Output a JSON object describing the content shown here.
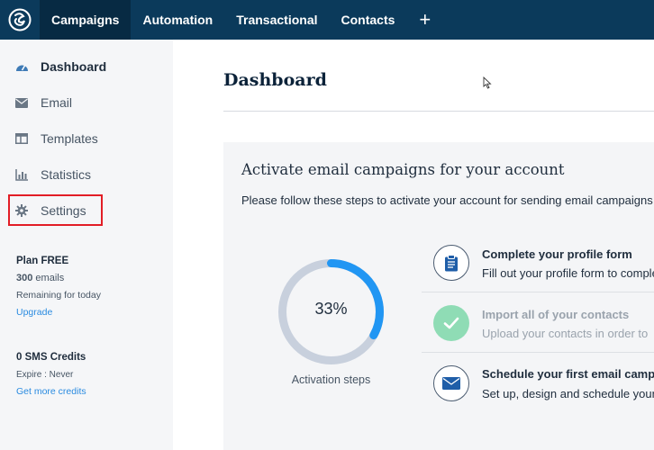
{
  "topnav": {
    "items": [
      {
        "label": "Campaigns",
        "active": true
      },
      {
        "label": "Automation",
        "active": false
      },
      {
        "label": "Transactional",
        "active": false
      },
      {
        "label": "Contacts",
        "active": false
      }
    ],
    "plus": "+",
    "bg_color": "#0b3a5b"
  },
  "sidebar": {
    "items": [
      {
        "label": "Dashboard",
        "icon": "speedometer-icon",
        "active": true
      },
      {
        "label": "Email",
        "icon": "envelope-icon",
        "active": false
      },
      {
        "label": "Templates",
        "icon": "template-icon",
        "active": false
      },
      {
        "label": "Statistics",
        "icon": "bar-chart-icon",
        "active": false
      },
      {
        "label": "Settings",
        "icon": "gear-icon",
        "active": false,
        "highlighted": true
      }
    ],
    "plan": {
      "title": "Plan FREE",
      "emails_count": "300",
      "emails_unit": "emails",
      "remaining": "Remaining for today",
      "upgrade": "Upgrade"
    },
    "sms": {
      "title": "0 SMS Credits",
      "expire": "Expire : Never",
      "link": "Get more credits"
    }
  },
  "main": {
    "title": "Dashboard",
    "card": {
      "title": "Activate email campaigns for your account",
      "subtitle": "Please follow these steps to activate your account for sending email campaigns",
      "progress_percent": 33,
      "progress_label": "33%",
      "progress_caption": "Activation steps",
      "steps": [
        {
          "title": "Complete your profile form",
          "desc": "Fill out your profile form to complete",
          "icon": "clipboard-icon",
          "done": false
        },
        {
          "title": "Import all of your contacts",
          "desc": "Upload your contacts in order to",
          "icon": "checkmark-icon",
          "done": true
        },
        {
          "title": "Schedule your first email campaign",
          "desc": "Set up, design and schedule your",
          "icon": "envelope-icon",
          "done": false
        }
      ]
    }
  },
  "colors": {
    "accent_blue": "#2a8be0",
    "progress_blue": "#2196f3",
    "progress_track": "#c8d0dd",
    "done_green": "#8fdcb5",
    "highlight_red": "#e21d26"
  }
}
